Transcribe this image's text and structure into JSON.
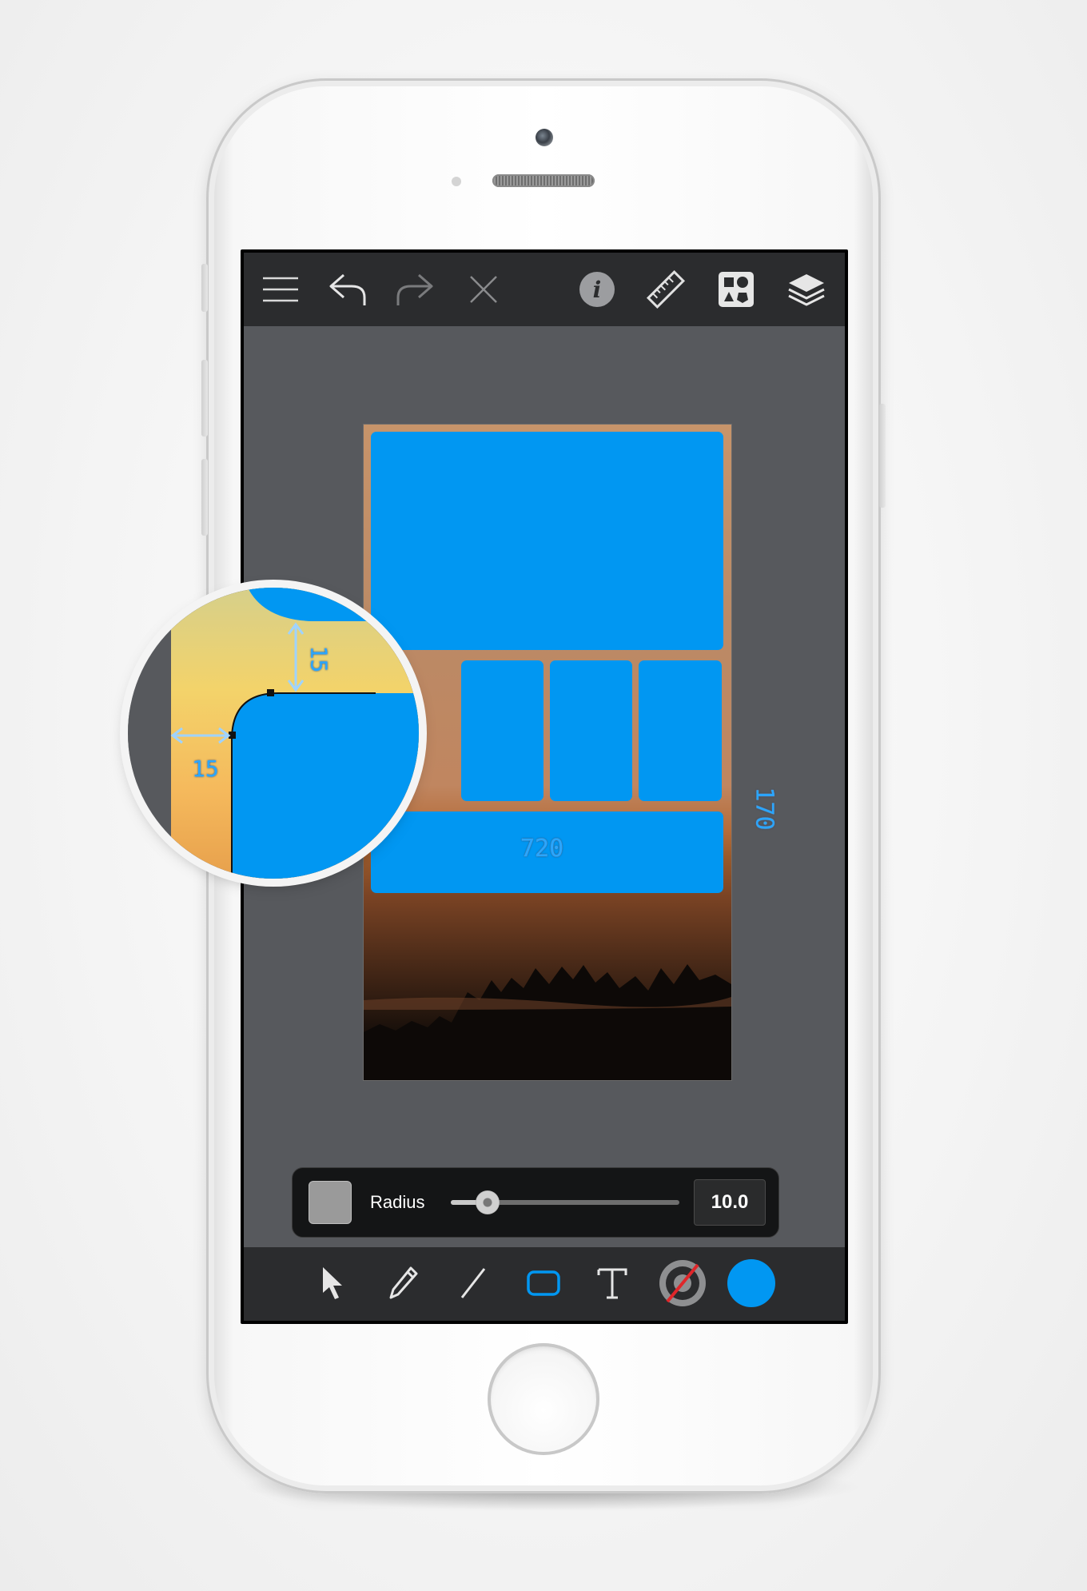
{
  "toolbar": {
    "left_icons": [
      "menu-icon",
      "undo-icon",
      "redo-icon",
      "close-icon"
    ],
    "right_icons": [
      "info-icon",
      "ruler-icon",
      "templates-icon",
      "layers-icon"
    ]
  },
  "canvas": {
    "width_label": "720",
    "height_label": "170"
  },
  "magnifier": {
    "spacing_horizontal": "15",
    "spacing_vertical": "15"
  },
  "radius_control": {
    "label": "Radius",
    "value": "10.0",
    "slider_level": 0.16
  },
  "tools": {
    "items": [
      "select-tool",
      "pencil-tool",
      "line-tool",
      "rectangle-tool",
      "text-tool",
      "stroke-color",
      "fill-color"
    ],
    "active": "rectangle-tool"
  },
  "colors": {
    "accent": "#0197f2",
    "toolbar_bg": "#2b2c2e",
    "canvas_bg": "#57595d",
    "dimension_text": "#2aa6ff"
  }
}
